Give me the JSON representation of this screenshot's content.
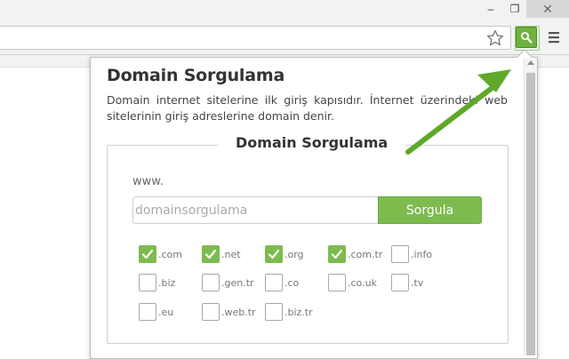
{
  "window": {
    "minimize_glyph": "–",
    "restore_glyph": "❐",
    "close_glyph": "✕"
  },
  "toolbar": {
    "icons": [
      "star-icon",
      "search-icon",
      "menu-icon"
    ],
    "extension_color": "#6fb23f"
  },
  "popup": {
    "title": "Domain Sorgulama",
    "description": "Domain internet sitelerine ilk giriş kapısıdır. İnternet üzerindeki web sitelerinin giriş adreslerine domain denir.",
    "form_title": "Domain Sorgulama",
    "prefix": "www.",
    "input_value": "",
    "input_placeholder": "domainsorgulama",
    "search_label": "Sorgula",
    "accent_color": "#7dbb4f",
    "tlds": [
      {
        "label": ".com",
        "checked": true
      },
      {
        "label": ".net",
        "checked": true
      },
      {
        "label": ".org",
        "checked": true
      },
      {
        "label": ".com.tr",
        "checked": true
      },
      {
        "label": ".info",
        "checked": false
      },
      {
        "label": ".biz",
        "checked": false
      },
      {
        "label": ".gen.tr",
        "checked": false
      },
      {
        "label": ".co",
        "checked": false
      },
      {
        "label": ".co.uk",
        "checked": false
      },
      {
        "label": ".tv",
        "checked": false
      },
      {
        "label": ".eu",
        "checked": false
      },
      {
        "label": ".web.tr",
        "checked": false
      },
      {
        "label": ".biz.tr",
        "checked": false
      }
    ]
  },
  "annotation": {
    "arrow_color": "#5fa82a"
  }
}
